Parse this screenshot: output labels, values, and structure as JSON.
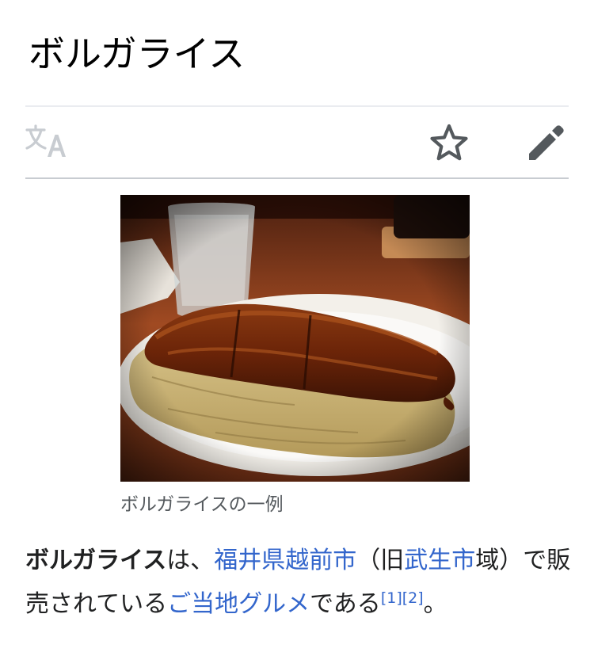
{
  "article": {
    "title": "ボルガライス"
  },
  "toolbar": {
    "language_icon": "translate-icon",
    "watch_icon": "star-icon",
    "edit_icon": "pencil-icon"
  },
  "figure": {
    "caption": "ボルガライスの一例"
  },
  "lead": {
    "term": "ボルガライス",
    "t1": "は、",
    "link_fukui": "福井県",
    "link_echizen": "越前市",
    "t2": "（旧",
    "link_takefu": "武生市",
    "t3": "域）で販売されている",
    "link_gourmet": "ご当地グルメ",
    "t4": "である",
    "ref1": "[1]",
    "ref2": "[2]",
    "t5": "。"
  },
  "colors": {
    "link": "#3366cc",
    "text": "#202122",
    "caption": "#54595d",
    "icon": "#54595d",
    "icon_disabled": "#c8ccd1"
  }
}
